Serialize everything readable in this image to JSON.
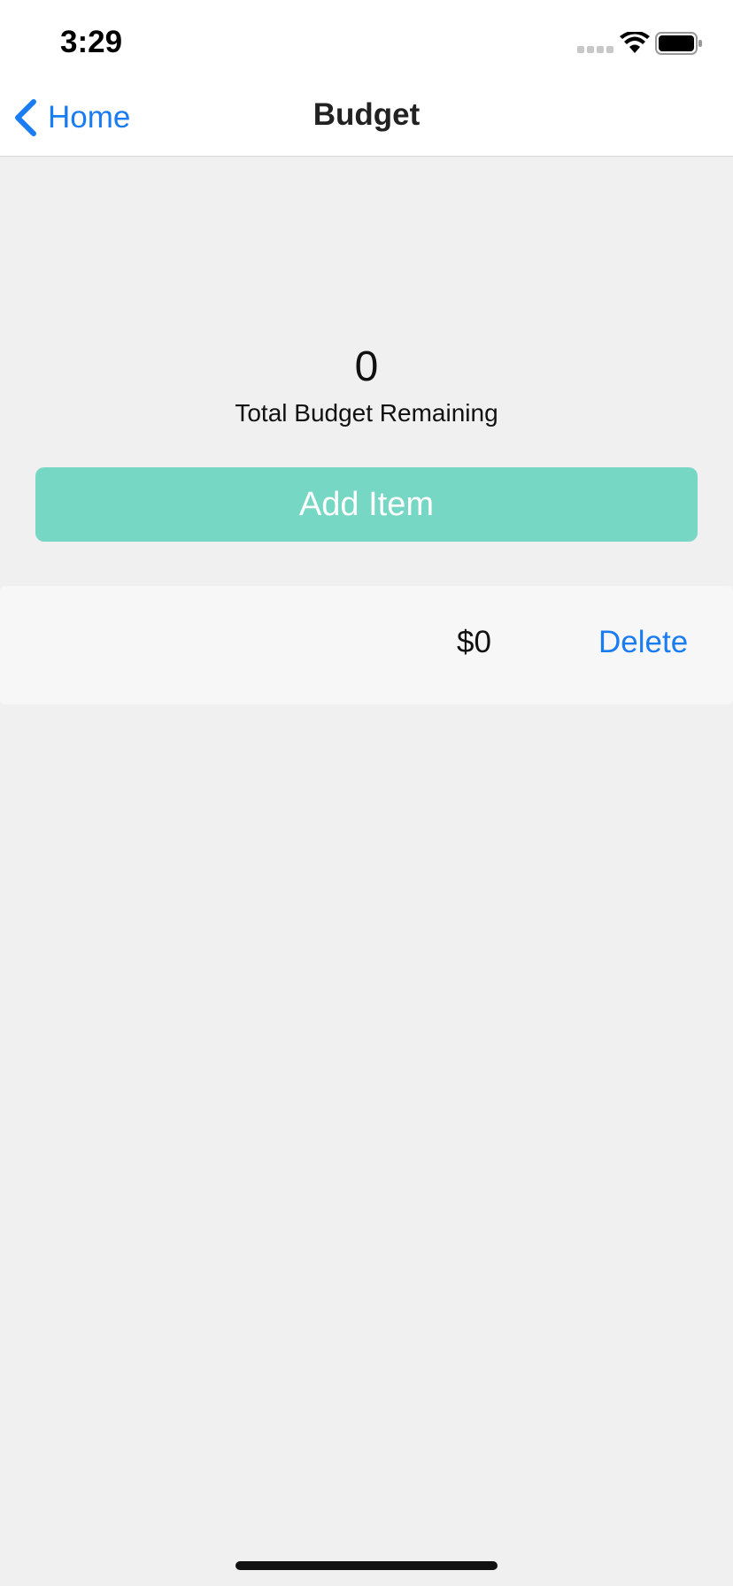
{
  "status_bar": {
    "time": "3:29",
    "icons": [
      "signal-dots-icon",
      "wifi-icon",
      "battery-icon"
    ]
  },
  "nav": {
    "back_label": "Home",
    "title": "Budget"
  },
  "summary": {
    "total_value": "0",
    "total_label": "Total Budget Remaining"
  },
  "actions": {
    "add_item_label": "Add Item"
  },
  "items": [
    {
      "amount": "$0",
      "delete_label": "Delete"
    }
  ],
  "colors": {
    "accent_blue": "#1a7cf2",
    "add_button_bg": "#76d7c4",
    "background": "#f0f0f0"
  }
}
